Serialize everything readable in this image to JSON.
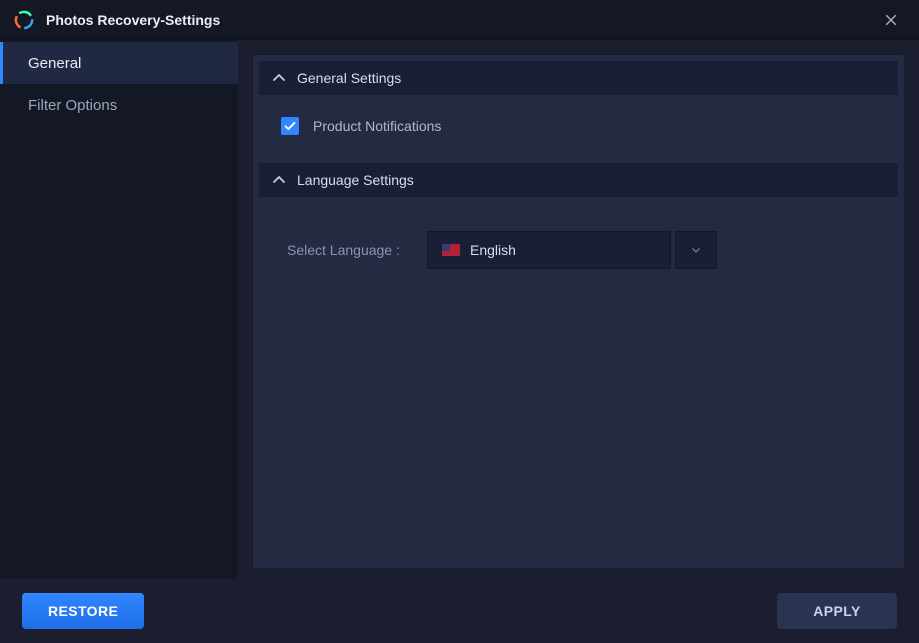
{
  "titlebar": {
    "title": "Photos Recovery-Settings"
  },
  "sidebar": {
    "items": [
      {
        "label": "General",
        "selected": true
      },
      {
        "label": "Filter Options",
        "selected": false
      }
    ]
  },
  "sections": {
    "general": {
      "header": "General Settings",
      "notifications_label": "Product Notifications",
      "notifications_checked": true
    },
    "language": {
      "header": "Language Settings",
      "select_label": "Select Language :",
      "selected": "English"
    }
  },
  "footer": {
    "restore_label": "RESTORE",
    "apply_label": "APPLY"
  }
}
